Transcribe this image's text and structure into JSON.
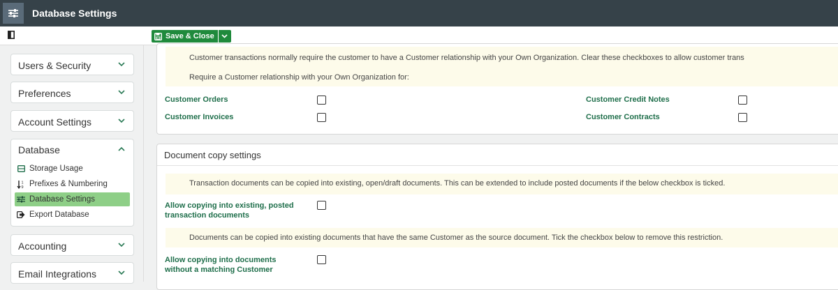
{
  "window": {
    "title": "Database Settings"
  },
  "toolbar": {
    "save_close_label": "Save & Close"
  },
  "sidebar": {
    "groups": [
      {
        "label": "Users & Security"
      },
      {
        "label": "Preferences"
      },
      {
        "label": "Account Settings"
      },
      {
        "label": "Database"
      },
      {
        "label": "Accounting"
      },
      {
        "label": "Email Integrations"
      }
    ],
    "database_items": [
      {
        "label": "Storage Usage",
        "icon": "storage-icon"
      },
      {
        "label": "Prefixes & Numbering",
        "icon": "numbering-icon"
      },
      {
        "label": "Database Settings",
        "icon": "sliders-icon",
        "active": true
      },
      {
        "label": "Export Database",
        "icon": "export-icon"
      }
    ]
  },
  "customer_section": {
    "info_line1": "Customer transactions normally require the customer to have a Customer relationship with your Own Organization. Clear these checkboxes to allow customer trans",
    "info_line2": "Require a Customer relationship with your Own Organization for:",
    "fields": [
      {
        "label": "Customer Orders",
        "checked": false
      },
      {
        "label": "Customer Invoices",
        "checked": false
      },
      {
        "label": "Customer Credit Notes",
        "checked": false
      },
      {
        "label": "Customer Contracts",
        "checked": false
      }
    ]
  },
  "document_copy": {
    "title": "Document copy settings",
    "info1": "Transaction documents can be copied into existing, open/draft documents. This can be extended to include posted documents if the below checkbox is ticked.",
    "field1_line1": "Allow copying into existing, posted",
    "field1_line2": "transaction documents",
    "info2": "Documents can be copied into existing documents that have the same Customer as the source document. Tick the checkbox below to remove this restriction.",
    "field2_line1": "Allow copying into documents",
    "field2_line2": "without a matching Customer"
  },
  "colors": {
    "accent": "#1f8a3c",
    "label_green": "#1e6e4a",
    "active_item": "#8ecf87",
    "titlebar": "#364249",
    "info_bg": "#fdfbea"
  }
}
